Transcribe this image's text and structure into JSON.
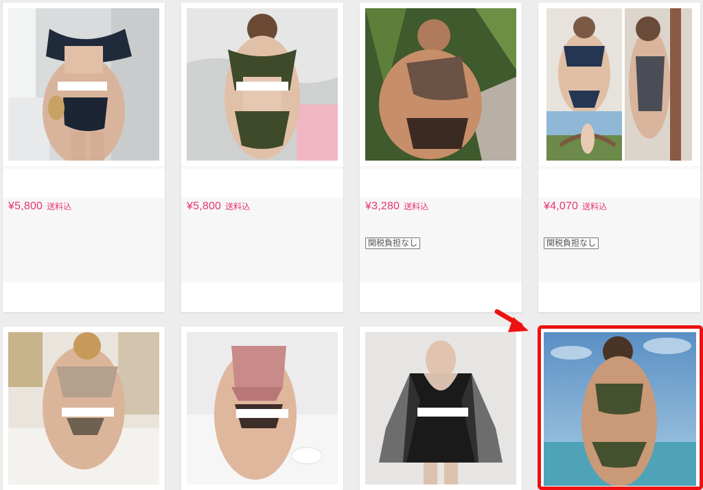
{
  "products": [
    {
      "price": "¥5,800",
      "shipping": "送料込",
      "badge": "",
      "image": "navy-ruffle-bikini-photo"
    },
    {
      "price": "¥5,800",
      "shipping": "送料込",
      "badge": "",
      "image": "olive-halter-swimsuit-photo"
    },
    {
      "price": "¥3,280",
      "shipping": "送料込",
      "badge": "関税負担なし",
      "image": "brown-one-shoulder-bikini-photo"
    },
    {
      "price": "¥4,070",
      "shipping": "送料込",
      "badge": "関税負担なし",
      "image": "navy-ruffle-bikini-collage-photo"
    },
    {
      "image": "beige-wrap-top-bikini-photo"
    },
    {
      "image": "pink-gingham-bikini-photo"
    },
    {
      "image": "black-sheer-sleeve-swimsuit-photo"
    },
    {
      "image": "olive-halter-bikini-beach-photo"
    }
  ],
  "annotation": {
    "highlight_color": "#ee1111",
    "arrow_color": "#ee1111",
    "target": "product-card-8"
  },
  "colors": {
    "price": "#e8346e",
    "background": "#ededed"
  }
}
